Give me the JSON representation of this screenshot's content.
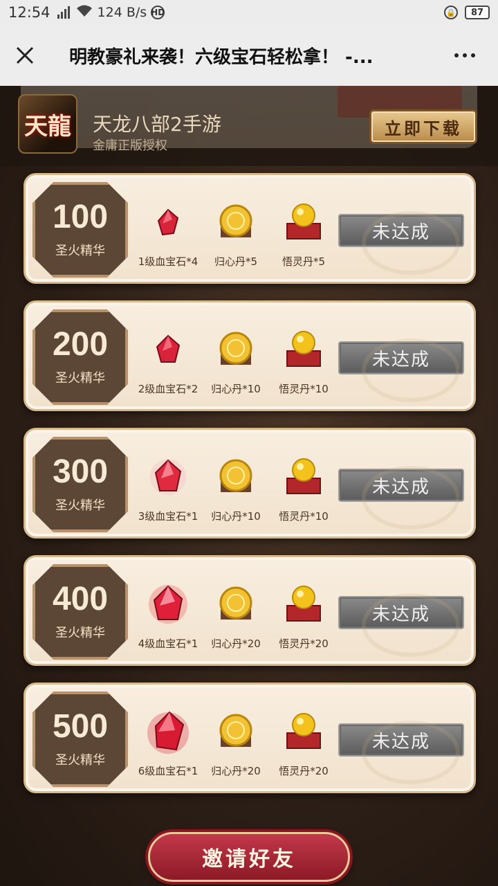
{
  "statusbar": {
    "time": "12:54",
    "network_type": "4G",
    "speed": "124 B/s",
    "hd": "HD",
    "battery": "87"
  },
  "titlebar": {
    "title": "明教豪礼来袭！六级宝石轻松拿！ -..."
  },
  "banner": {
    "logo_text": "天龍",
    "game_name": "天龙八部2手游",
    "subtitle": "金庸正版授权",
    "download_label": "立即下载"
  },
  "cards": [
    {
      "points": "100",
      "unit": "圣火精华",
      "items": [
        "1级血宝石*4",
        "归心丹*5",
        "悟灵丹*5"
      ],
      "status": "未达成"
    },
    {
      "points": "200",
      "unit": "圣火精华",
      "items": [
        "2级血宝石*2",
        "归心丹*10",
        "悟灵丹*10"
      ],
      "status": "未达成"
    },
    {
      "points": "300",
      "unit": "圣火精华",
      "items": [
        "3级血宝石*1",
        "归心丹*10",
        "悟灵丹*10"
      ],
      "status": "未达成"
    },
    {
      "points": "400",
      "unit": "圣火精华",
      "items": [
        "4级血宝石*1",
        "归心丹*20",
        "悟灵丹*20"
      ],
      "status": "未达成"
    },
    {
      "points": "500",
      "unit": "圣火精华",
      "items": [
        "6级血宝石*1",
        "归心丹*20",
        "悟灵丹*20"
      ],
      "status": "未达成"
    }
  ],
  "invite_label": "邀请好友"
}
